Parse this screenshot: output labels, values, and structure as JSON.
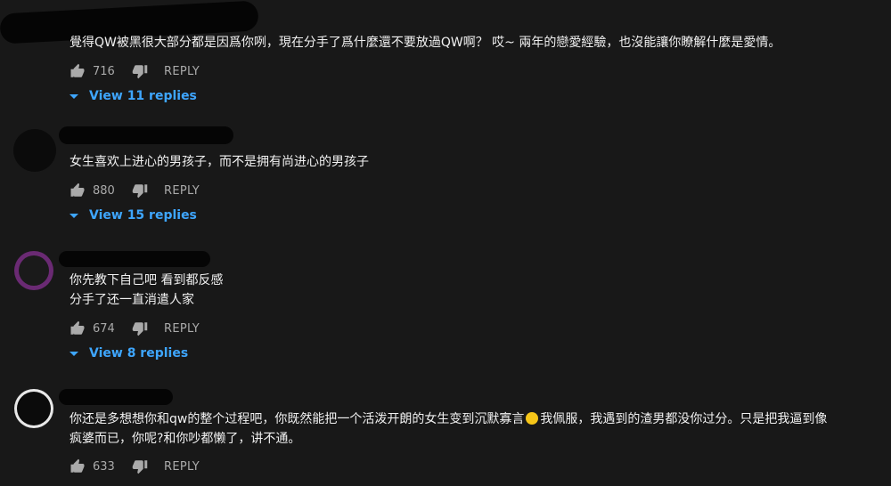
{
  "comments": [
    {
      "text_lines": [
        "覺得QW被黑很大部分都是因爲你咧，現在分手了爲什麼還不要放過QW啊？ 哎~ 兩年的戀愛經驗，也沒能讓你瞭解什麼是愛情。"
      ],
      "likes": "716",
      "reply_label": "REPLY",
      "view_replies_label": "View 11 replies"
    },
    {
      "text_lines": [
        "女生喜欢上进心的男孩子，而不是拥有尚进心的男孩子"
      ],
      "likes": "880",
      "reply_label": "REPLY",
      "view_replies_label": "View 15 replies"
    },
    {
      "text_lines": [
        "你先教下自己吧 看到都反感",
        "分手了还一直消遣人家"
      ],
      "likes": "674",
      "reply_label": "REPLY",
      "view_replies_label": "View 8 replies"
    },
    {
      "text_lines": [
        "你还是多想想你和qw的整个过程吧，你既然能把一个活泼开朗的女生变到沉默寡言",
        "我佩服，我遇到的渣男都没你过分。只是把我逼到像",
        "疯婆而已，你呢?和你吵都懒了，讲不通。"
      ],
      "emoji": "slightly-smiling-face",
      "likes": "633",
      "reply_label": "REPLY"
    }
  ],
  "colors": {
    "background": "#181818",
    "text": "#f1f1f1",
    "secondary": "#aaaaaa",
    "link": "#3ea6ff"
  },
  "icons": [
    "thumbs-up-icon",
    "thumbs-down-icon",
    "chevron-down-icon"
  ]
}
